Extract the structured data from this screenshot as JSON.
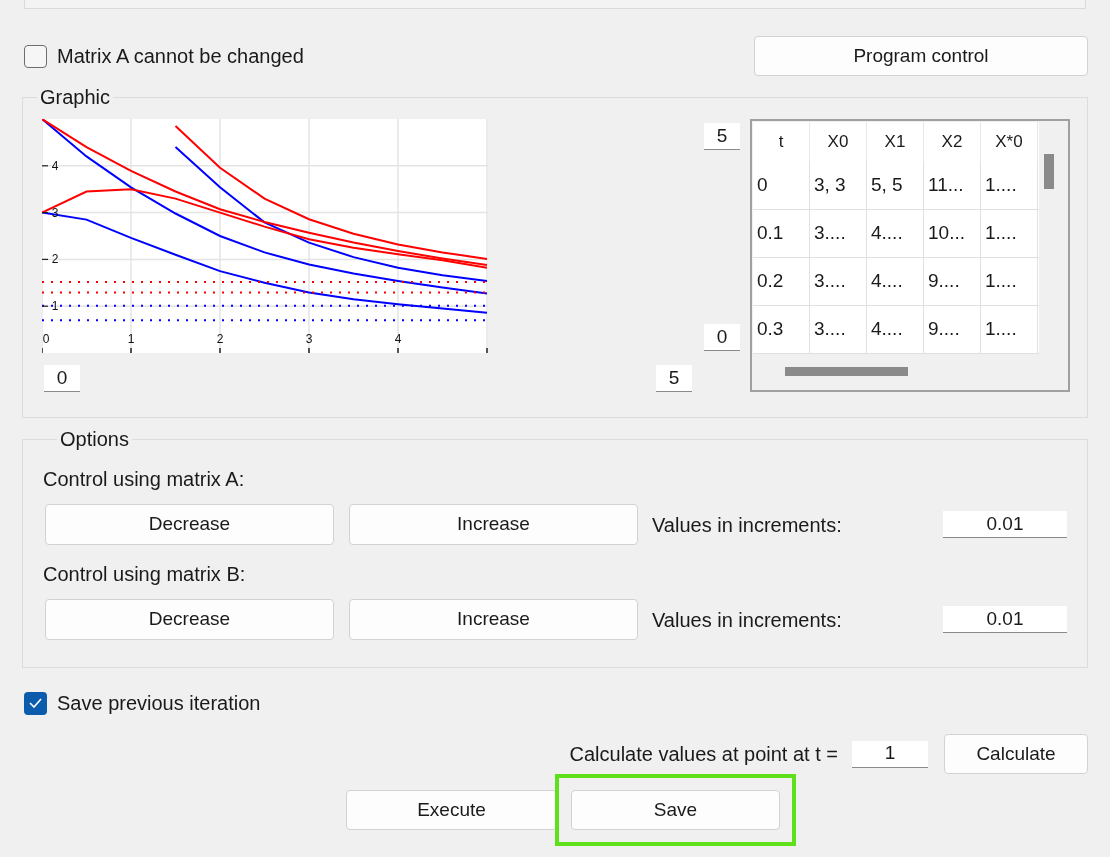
{
  "lock_matrix": {
    "label": "Matrix A cannot be changed",
    "checked": false
  },
  "program_control_button": "Program control",
  "graphic": {
    "title": "Graphic",
    "x_min": "0",
    "x_max": "5",
    "y_max": "5",
    "y_min": "0",
    "chart_data": {
      "type": "line",
      "grid": true,
      "xlim": [
        0,
        5
      ],
      "ylim": [
        0,
        5
      ],
      "xticks": [
        0,
        1,
        2,
        3,
        4
      ],
      "yticks": [
        1,
        2,
        3,
        4
      ],
      "x": [
        0,
        0.5,
        1,
        1.5,
        2,
        2.5,
        3,
        3.5,
        4,
        4.5,
        5
      ],
      "series": [
        {
          "color": "#0000ff",
          "line_style": "solid",
          "values": [
            5,
            4.2,
            3.54,
            2.98,
            2.5,
            2.15,
            1.89,
            1.7,
            1.54,
            1.4,
            1.27
          ]
        },
        {
          "color": "#0000ff",
          "line_style": "solid",
          "values": [
            3,
            2.85,
            2.46,
            2.1,
            1.75,
            1.5,
            1.29,
            1.15,
            1.04,
            0.95,
            0.86
          ]
        },
        {
          "color": "#0000ff",
          "line_style": "solid",
          "values": [
            null,
            null,
            null,
            4.4,
            3.54,
            2.79,
            2.36,
            2.05,
            1.82,
            1.66,
            1.54
          ]
        },
        {
          "color": "#ff0000",
          "line_style": "solid",
          "values": [
            5,
            4.4,
            3.89,
            3.45,
            3.07,
            2.8,
            2.57,
            2.36,
            2.18,
            2.02,
            1.88
          ]
        },
        {
          "color": "#ff0000",
          "line_style": "solid",
          "values": [
            3,
            3.45,
            3.5,
            3.3,
            3.0,
            2.7,
            2.43,
            2.25,
            2.11,
            1.98,
            1.82
          ]
        },
        {
          "color": "#ff0000",
          "line_style": "solid",
          "values": [
            null,
            null,
            null,
            4.85,
            3.96,
            3.3,
            2.86,
            2.55,
            2.32,
            2.15,
            2.01
          ]
        },
        {
          "color": "#ff0000",
          "line_style": "dotted",
          "values": [
            1.52,
            1.52,
            1.52,
            1.52,
            1.52,
            1.52,
            1.52,
            1.52,
            1.52,
            1.52,
            1.52
          ]
        },
        {
          "color": "#ff0000",
          "line_style": "dotted",
          "values": [
            1.29,
            1.29,
            1.29,
            1.29,
            1.29,
            1.29,
            1.29,
            1.29,
            1.29,
            1.29,
            1.29
          ]
        },
        {
          "color": "#0000ff",
          "line_style": "dotted",
          "values": [
            1.01,
            1.01,
            1.01,
            1.01,
            1.01,
            1.01,
            1.01,
            1.01,
            1.01,
            1.01,
            1.01
          ]
        },
        {
          "color": "#0000ff",
          "line_style": "dotted",
          "values": [
            0.7,
            0.7,
            0.7,
            0.7,
            0.7,
            0.7,
            0.7,
            0.7,
            0.7,
            0.7,
            0.7
          ]
        }
      ]
    },
    "table": {
      "columns": [
        "t",
        "X0",
        "X1",
        "X2",
        "X*0"
      ],
      "rows": [
        [
          "0",
          "3, 3",
          "5, 5",
          "11...",
          "1...."
        ],
        [
          "0.1",
          "3....",
          "4....",
          "10...",
          "1...."
        ],
        [
          "0.2",
          "3....",
          "4....",
          "9....",
          "1...."
        ],
        [
          "0.3",
          "3....",
          "4....",
          "9....",
          "1...."
        ]
      ]
    }
  },
  "options": {
    "title": "Options",
    "controls": [
      {
        "label": "Control using matrix A:",
        "decrease": "Decrease",
        "increase": "Increase",
        "increment_label": "Values in increments:",
        "increment": "0.01"
      },
      {
        "label": "Control using matrix B:",
        "decrease": "Decrease",
        "increase": "Increase",
        "increment_label": "Values in increments:",
        "increment": "0.01"
      }
    ]
  },
  "save_previous": {
    "label": "Save previous iteration",
    "checked": true
  },
  "calculate": {
    "label": "Calculate values at point at t =",
    "value": "1",
    "button": "Calculate"
  },
  "buttons": [
    {
      "label": "Execute",
      "highlighted": false
    },
    {
      "label": "Save",
      "highlighted": true
    }
  ]
}
